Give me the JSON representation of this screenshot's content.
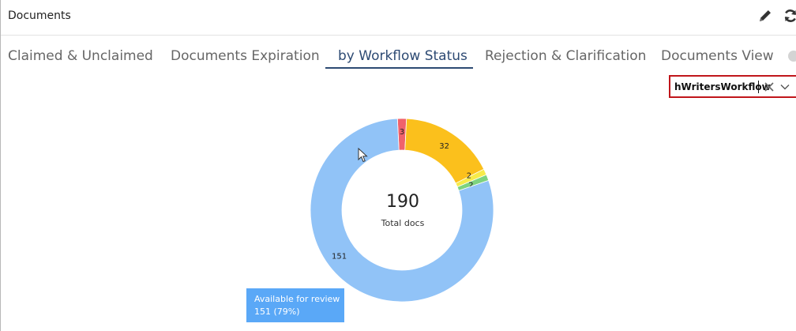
{
  "header": {
    "title": "Documents",
    "edit_icon": "pencil-icon",
    "refresh_icon": "refresh-icon"
  },
  "tabs": [
    {
      "label": "Claimed & Unclaimed",
      "active": false
    },
    {
      "label": "Documents Expiration",
      "active": false
    },
    {
      "label": "by Workflow Status",
      "active": true
    },
    {
      "label": "Rejection & Clarification",
      "active": false
    },
    {
      "label": "Documents View",
      "active": false
    }
  ],
  "workflow_select": {
    "value": "hWritersWorkflow"
  },
  "chart": {
    "center_value": "190",
    "center_label": "Total docs",
    "tooltip_title": "Available for review",
    "tooltip_value": "151 (79%)"
  },
  "colors": {
    "accent": "#2d4a73",
    "highlight_border": "#c0161b",
    "tooltip_bg": "#5aa8f7"
  },
  "chart_data": {
    "type": "pie",
    "donut": true,
    "title": "",
    "total": 190,
    "slices": [
      {
        "value": 3,
        "label": "3",
        "color": "#f0626b"
      },
      {
        "value": 32,
        "label": "32",
        "color": "#fbc01c"
      },
      {
        "value": 2,
        "label": "2",
        "color": "#f7eb4a"
      },
      {
        "value": 2,
        "label": "2",
        "color": "#7ed37f"
      },
      {
        "value": 151,
        "label": "151",
        "color": "#91c3f7",
        "name": "Available for review",
        "percent": 79
      }
    ]
  }
}
